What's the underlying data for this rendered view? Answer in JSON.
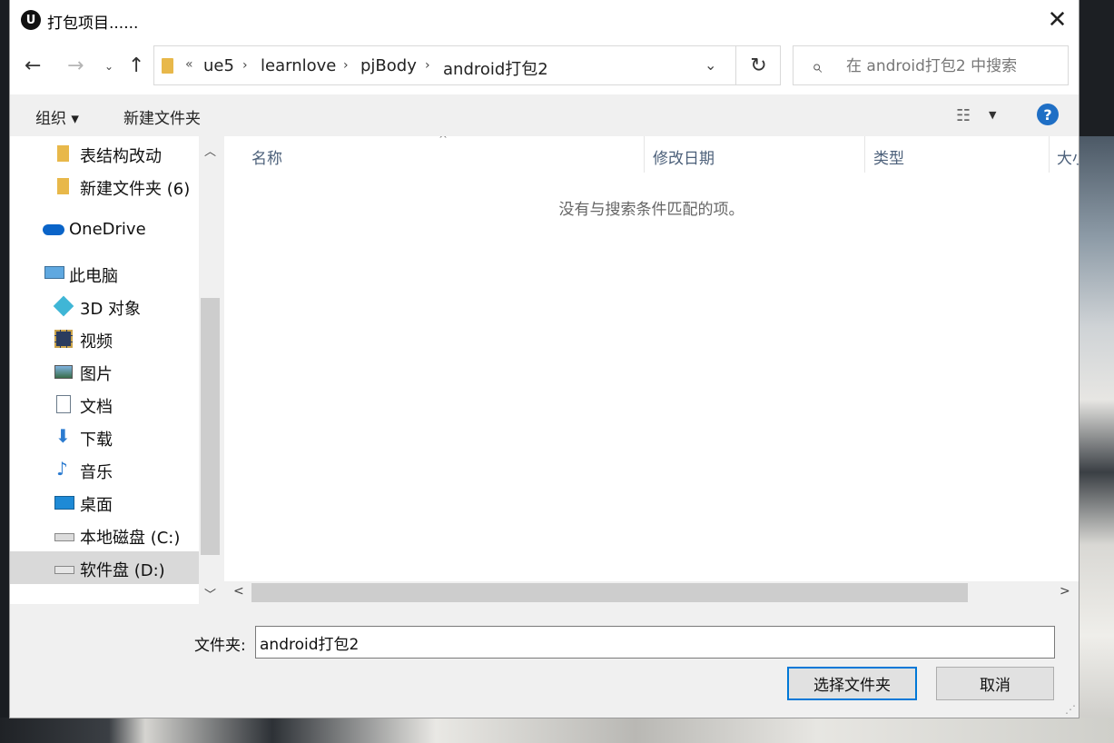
{
  "window": {
    "title": "打包项目......",
    "close_label": "✕",
    "logo": "U"
  },
  "nav": {
    "back": "←",
    "forward": "→",
    "recent": "⌄",
    "up": "↑"
  },
  "address": {
    "overflow": "«",
    "crumbs": [
      "ue5",
      "learnlove",
      "pjBody",
      "android打包2"
    ],
    "separator": "›",
    "dropdown": "⌄",
    "refresh": "↻"
  },
  "search": {
    "placeholder": "在 android打包2 中搜索",
    "icon": "⌕"
  },
  "toolbar": {
    "organize": "组织 ▾",
    "new_folder": "新建文件夹",
    "view_icon": "☷",
    "view_drop": "▼",
    "help": "?"
  },
  "sidebar": {
    "items": [
      {
        "label": "表结构改动",
        "icon": "folder-icon"
      },
      {
        "label": "新建文件夹 (6)",
        "icon": "folder-icon"
      },
      {
        "label": "OneDrive",
        "icon": "cloud-icon"
      },
      {
        "label": "此电脑",
        "icon": "computer-icon"
      },
      {
        "label": "3D 对象",
        "icon": "cube-icon"
      },
      {
        "label": "视频",
        "icon": "video-icon"
      },
      {
        "label": "图片",
        "icon": "picture-icon"
      },
      {
        "label": "文档",
        "icon": "document-icon"
      },
      {
        "label": "下载",
        "icon": "download-icon"
      },
      {
        "label": "音乐",
        "icon": "music-icon"
      },
      {
        "label": "桌面",
        "icon": "desktop-icon"
      },
      {
        "label": "本地磁盘 (C:)",
        "icon": "drive-c-icon"
      },
      {
        "label": "软件盘 (D:)",
        "icon": "drive-icon"
      }
    ],
    "selected": "软件盘 (D:)"
  },
  "columns": [
    "名称",
    "修改日期",
    "类型",
    "大小"
  ],
  "content": {
    "empty_message": "没有与搜索条件匹配的项。",
    "sort_arrow": "^"
  },
  "scroll": {
    "up": "︿",
    "down": "﹀",
    "left": "<",
    "right": ">"
  },
  "footer": {
    "folder_label": "文件夹:",
    "folder_value": "android打包2",
    "select_button": "选择文件夹",
    "cancel_button": "取消",
    "grip": "⋰"
  },
  "colors": {
    "accent": "#0078d7",
    "help": "#1f6fc5",
    "folder": "#e8b84a",
    "selected_bg": "#d9d9d9"
  }
}
